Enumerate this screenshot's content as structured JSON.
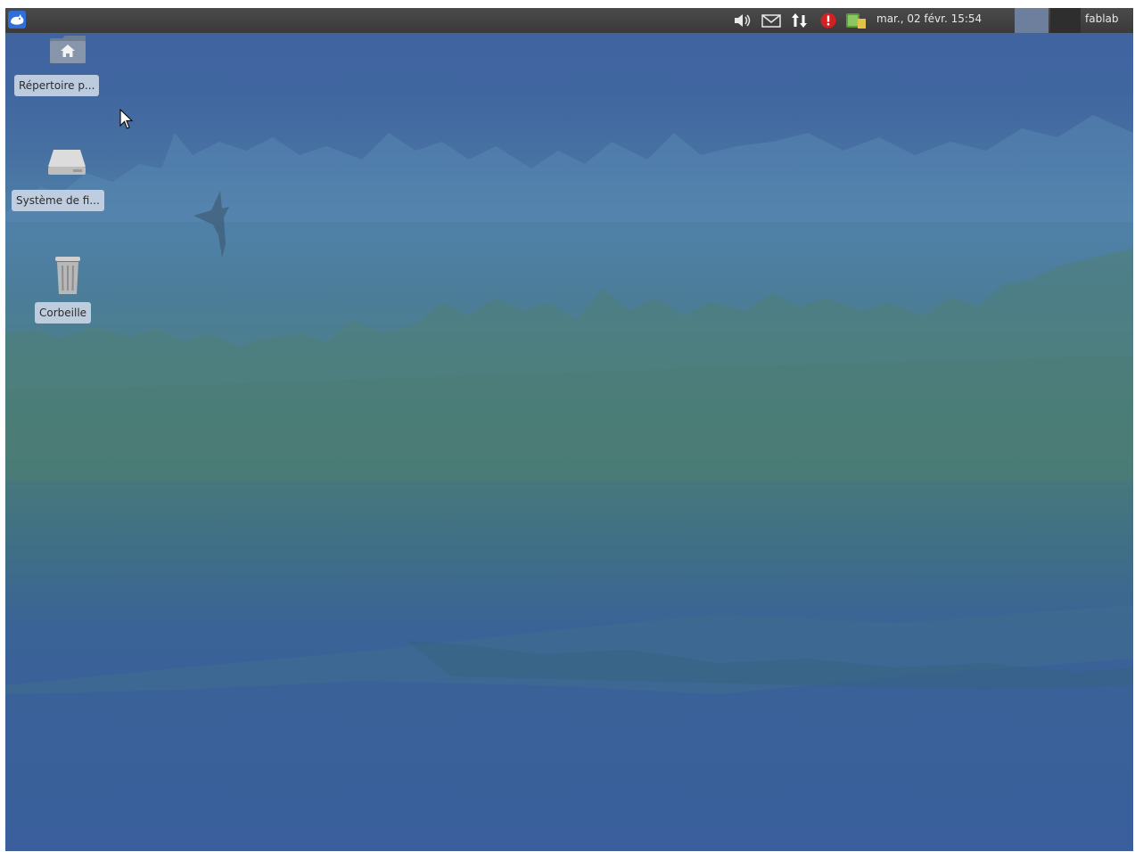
{
  "panel": {
    "app_menu_icon": "xfce-mouse-icon",
    "tray_icons": [
      "volume-icon",
      "mail-icon",
      "network-arrows-icon",
      "alert-icon",
      "update-manager-icon"
    ],
    "clock": "mar., 02 févr.  15:54",
    "user_label": "fablab"
  },
  "desktop": {
    "icons": [
      {
        "label": "Répertoire p...",
        "icon": "home-folder-icon"
      },
      {
        "label": "Système de fi...",
        "icon": "drive-icon"
      },
      {
        "label": "Corbeille",
        "icon": "trash-icon"
      }
    ]
  },
  "colors": {
    "panel_bg": "#3a3a3a",
    "wallpaper_blue": "#3f63a0",
    "wallpaper_green": "#4a7c78",
    "label_bg": "#c8d4e4"
  }
}
